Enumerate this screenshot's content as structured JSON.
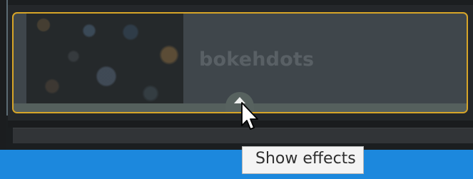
{
  "clip": {
    "title": "bokehdots",
    "border_color": "#d7a528",
    "thumbnail_icon": "bokeh-thumbnail"
  },
  "effects_button": {
    "icon": "chevron-up-icon"
  },
  "tooltip": {
    "text": "Show effects"
  },
  "cursor": {
    "icon": "mouse-pointer-icon"
  },
  "colors": {
    "selection": "#d7a528",
    "taskbar": "#1c88dd"
  }
}
